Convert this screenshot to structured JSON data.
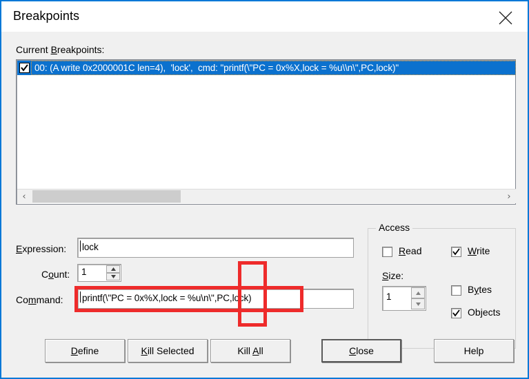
{
  "window": {
    "title": "Breakpoints",
    "close_icon": "close-icon",
    "accent": "#0078d7"
  },
  "list": {
    "label": "Current Breakpoints:",
    "label_accel": "B",
    "rows": [
      {
        "checked": true,
        "text": "00: (A write 0x2000001C len=4),  'lock',  cmd: \"printf(\\\"PC = 0x%X,lock = %u\\\\n\\\",PC,lock)\"",
        "selected": true
      }
    ],
    "scrollbar": {
      "left_arrow": "‹",
      "right_arrow": "›"
    }
  },
  "form": {
    "expression": {
      "label": "Expression:",
      "accel": "E",
      "value": "lock",
      "placeholder": ""
    },
    "count": {
      "label": "Count:",
      "accel": "o",
      "value": "1"
    },
    "command": {
      "label": "Command:",
      "accel": "m",
      "value": "printf(\\\"PC = 0x%X,lock = %u\\n\\\",PC,lock)",
      "placeholder": ""
    }
  },
  "access": {
    "title": "Access",
    "read": {
      "label": "Read",
      "accel": "R",
      "checked": false
    },
    "write": {
      "label": "Write",
      "accel": "W",
      "checked": true
    },
    "size": {
      "label": "Size:",
      "accel": "S",
      "value": "1"
    },
    "bytes": {
      "label": "Bytes",
      "accel": "y",
      "checked": false
    },
    "objects": {
      "label": "Objects",
      "accel": "j",
      "checked": true
    }
  },
  "buttons": [
    {
      "label": "Define",
      "accel": "D",
      "focused": false
    },
    {
      "label": "Kill Selected",
      "accel": "K",
      "focused": false
    },
    {
      "label": "Kill All",
      "accel": "A",
      "focused": false
    },
    {
      "label": "Close",
      "accel": "C",
      "focused": true
    },
    {
      "label": "Help",
      "accel": "",
      "focused": false
    }
  ],
  "annotations": {
    "color": "#ee2b2b",
    "highlight_command_field": true,
    "highlight_vertical_marker": true
  }
}
